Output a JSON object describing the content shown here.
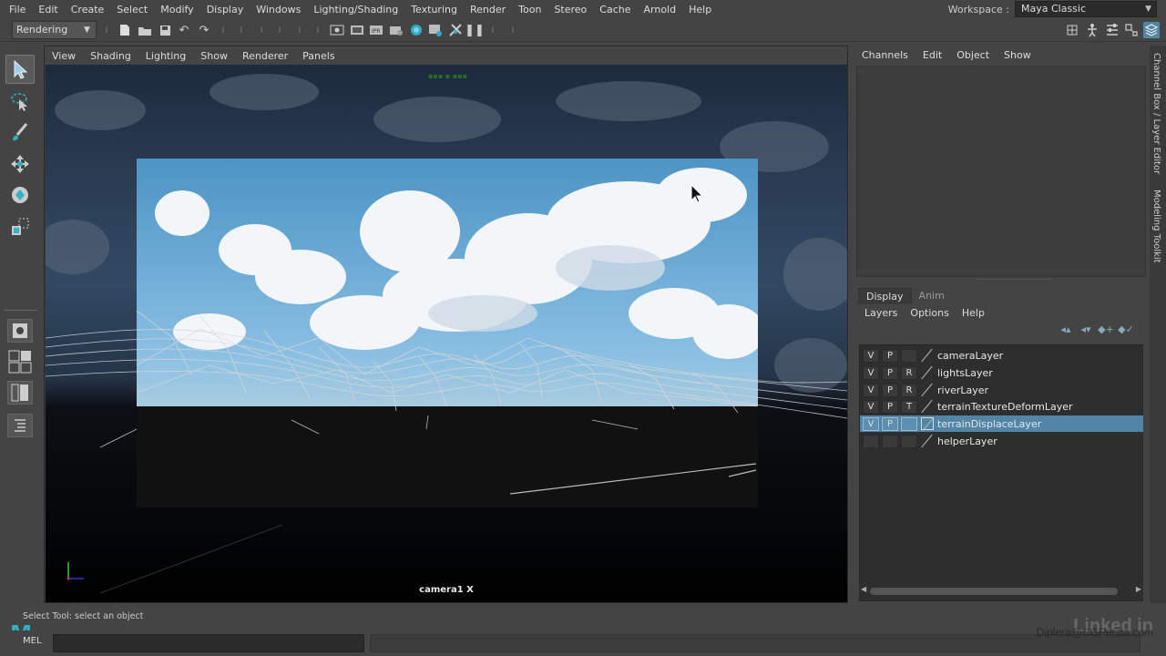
{
  "menubar": {
    "items": [
      "File",
      "Edit",
      "Create",
      "Select",
      "Modify",
      "Display",
      "Windows",
      "Lighting/Shading",
      "Texturing",
      "Render",
      "Toon",
      "Stereo",
      "Cache",
      "Arnold",
      "Help"
    ],
    "workspace_label": "Workspace :",
    "workspace_value": "Maya Classic"
  },
  "statusline": {
    "menuset": "Rendering",
    "icons": [
      "new-scene-icon",
      "open-scene-icon",
      "save-scene-icon",
      "undo-icon",
      "redo-icon",
      "render-frame-icon",
      "render-sequence-icon",
      "ipr-render-icon",
      "render-settings-icon",
      "hypershade-icon",
      "render-view-icon",
      "playblast-icon",
      "pause-icon"
    ],
    "right_icons": [
      "modeling-toolkit-icon",
      "character-controls-icon",
      "attribute-editor-icon",
      "tool-settings-icon",
      "channel-box-icon"
    ]
  },
  "toolbox": {
    "tools": [
      "select-tool-icon",
      "lasso-tool-icon",
      "paint-select-tool-icon",
      "move-tool-icon",
      "rotate-tool-icon",
      "scale-tool-icon"
    ],
    "layouts": [
      "single-perspective-layout-icon",
      "four-view-layout-icon",
      "persp-outliner-layout-icon",
      "outliner-layout-icon"
    ]
  },
  "viewport": {
    "menu": [
      "View",
      "Shading",
      "Lighting",
      "Show",
      "Renderer",
      "Panels"
    ],
    "camera_label": "camera1 X"
  },
  "channel_box": {
    "menu": [
      "Channels",
      "Edit",
      "Object",
      "Show"
    ]
  },
  "layer_editor": {
    "tabs": [
      "Display",
      "Anim"
    ],
    "active_tab": "Display",
    "menu": [
      "Layers",
      "Options",
      "Help"
    ],
    "layers": [
      {
        "v": "V",
        "p": "P",
        "t": "",
        "name": "cameraLayer"
      },
      {
        "v": "V",
        "p": "P",
        "t": "R",
        "name": "lightsLayer"
      },
      {
        "v": "V",
        "p": "P",
        "t": "R",
        "name": "riverLayer"
      },
      {
        "v": "V",
        "p": "P",
        "t": "T",
        "name": "terrainTextureDeformLayer"
      },
      {
        "v": "V",
        "p": "P",
        "t": "",
        "name": "terrainDisplaceLayer"
      },
      {
        "v": "",
        "p": "",
        "t": "",
        "name": "helperLayer"
      }
    ],
    "selected_layer": "terrainDisplaceLayer"
  },
  "side_tabs": [
    "Channel Box / Layer Editor",
    "Modeling Toolkit"
  ],
  "helpline": "Select Tool: select an object",
  "cmdline": {
    "label": "MEL"
  },
  "watermark": "Diplera@CGPersia.com",
  "colors": {
    "accent": "#5285a6",
    "maya_logo": "#2fb3c9"
  }
}
